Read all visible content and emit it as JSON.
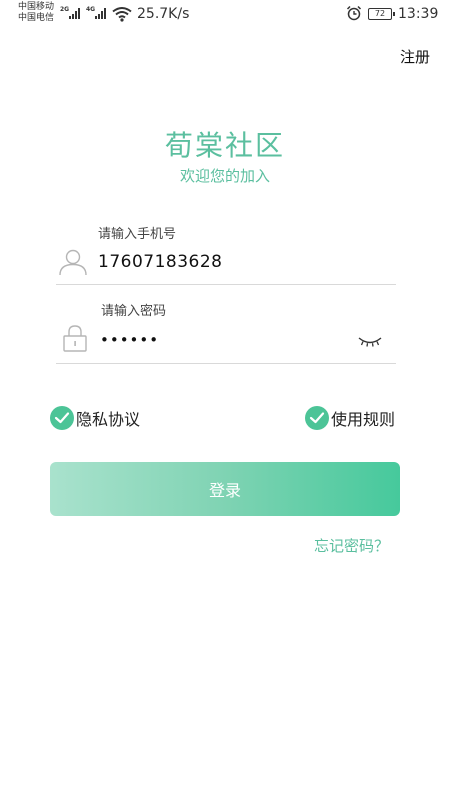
{
  "status_bar": {
    "carrier_1": "中国移动",
    "carrier_2": "中国电信",
    "sim1_network": "2G",
    "sim2_network": "4G",
    "net_speed": "25.7K/s",
    "battery_level": "72",
    "time": "13:39",
    "icons": [
      "signal-icon",
      "wifi-icon",
      "alarm-icon",
      "battery-icon"
    ]
  },
  "header": {
    "register_label": "注册"
  },
  "brand": {
    "title": "荀棠社区",
    "subtitle": "欢迎您的加入",
    "accent_color": "#5bbf9f"
  },
  "form": {
    "phone": {
      "label": "请输入手机号",
      "value": "17607183628",
      "icon": "user-icon"
    },
    "password": {
      "label": "请输入密码",
      "value": "••••••",
      "icon": "lock-icon",
      "toggle_icon": "eye-closed-icon"
    }
  },
  "agreements": {
    "privacy_label": "隐私协议",
    "privacy_checked": true,
    "rules_label": "使用规则",
    "rules_checked": true,
    "check_color": "#4cc497"
  },
  "actions": {
    "login_label": "登录",
    "forgot_label": "忘记密码？"
  }
}
